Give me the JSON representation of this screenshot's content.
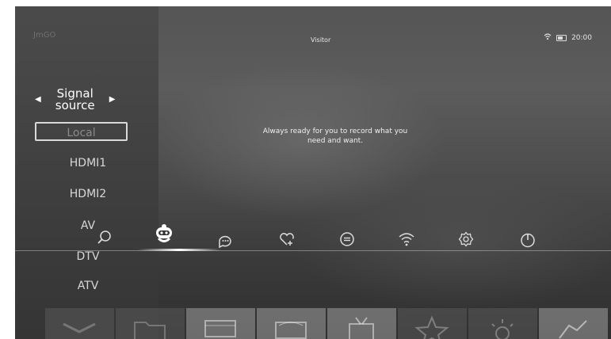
{
  "header": {
    "logo_text": "JmGO",
    "title": "Visitor",
    "time": "20:00",
    "wifi_icon": "wifi-icon",
    "battery_icon": "battery-icon"
  },
  "signal_source": {
    "title": "Signal source",
    "items": [
      "Local",
      "HDMI1",
      "HDMI2",
      "AV",
      "DTV",
      "ATV"
    ],
    "selected": "Local"
  },
  "message": "Always ready for you to record what you need and want.",
  "toolbar": {
    "icons": [
      "search-icon",
      "robot-icon",
      "chat-icon",
      "favorite-add-icon",
      "menu-icon",
      "wifi-icon",
      "settings-icon",
      "power-icon"
    ],
    "selected": "robot-icon"
  },
  "tiles": [
    "tile-1",
    "tile-2",
    "tile-3",
    "tile-4",
    "tile-5",
    "tile-6",
    "tile-7",
    "tile-8"
  ]
}
